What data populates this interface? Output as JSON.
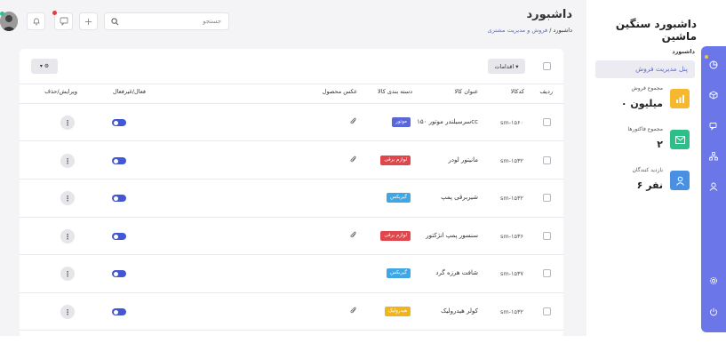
{
  "app": {
    "brand": "داشبورد سنگین ماشین",
    "page_title": "داشبورد",
    "breadcrumb": {
      "home": "داشبورد",
      "sep": "/",
      "current": "فروش و مدیریت مشتری"
    }
  },
  "search": {
    "placeholder": "جستجو"
  },
  "sidebar": {
    "section_title": "داشبورد",
    "active_item": "پنل مدیریت فروش",
    "stats": [
      {
        "label": "مجموع فروش",
        "value": "۰ میلیون",
        "color": "#f5b82e",
        "icon": "chart-icon"
      },
      {
        "label": "مجموع فاکتورها",
        "value": "۲",
        "color": "#2dbe8a",
        "icon": "mail-icon"
      },
      {
        "label": "بازدید کنندگان",
        "value": "۶ نفر",
        "color": "#4a90e2",
        "icon": "user-icon"
      }
    ]
  },
  "rail_icons": [
    "dashboard-icon",
    "box-icon",
    "chat-icon",
    "sitemap-icon",
    "user-icon",
    "settings-icon",
    "power-icon"
  ],
  "toolbar": {
    "bulk_actions": "اقدامات ▾",
    "settings_label": "▾ ⚙"
  },
  "table": {
    "headers": {
      "row": "ردیف",
      "code": "کدکالا",
      "title": "عنوان کالا",
      "category": "دسته بندی کالا",
      "image": "عکس محصول",
      "status": "فعال/غیرفعال",
      "actions": "ویرایش/حذف"
    },
    "rows": [
      {
        "code": "sm-۱۵۶۰",
        "title": "سرسیلندر موتور ۱۵۰cc",
        "category": "موتور",
        "cat_color": "#5a67d8",
        "active": true
      },
      {
        "code": "sm-۱۵۳۲",
        "title": "مانیتور لودر",
        "category": "لوازم برقی",
        "cat_color": "#e0474c",
        "active": true
      },
      {
        "code": "sm-۱۵۳۲",
        "title": "شیربرقی پمپ",
        "category": "گیربکس",
        "cat_color": "#3fa7e5",
        "active": true
      },
      {
        "code": "sm-۱۵۳۶",
        "title": "سنسور پمپ انژکتور",
        "category": "لوازم برقی",
        "cat_color": "#e0474c",
        "active": true
      },
      {
        "code": "sm-۱۵۳۷",
        "title": "شافت هرزه گرد",
        "category": "گیربکس",
        "cat_color": "#3fa7e5",
        "active": true
      },
      {
        "code": "sm-۱۵۳۲",
        "title": "کولر هیدرولیک",
        "category": "هیدرولیک",
        "cat_color": "#f1b51c",
        "active": true
      }
    ]
  },
  "colors": {
    "accent": "#6b77e8",
    "toggle": "#4356d4",
    "link": "#5e6ad2"
  }
}
